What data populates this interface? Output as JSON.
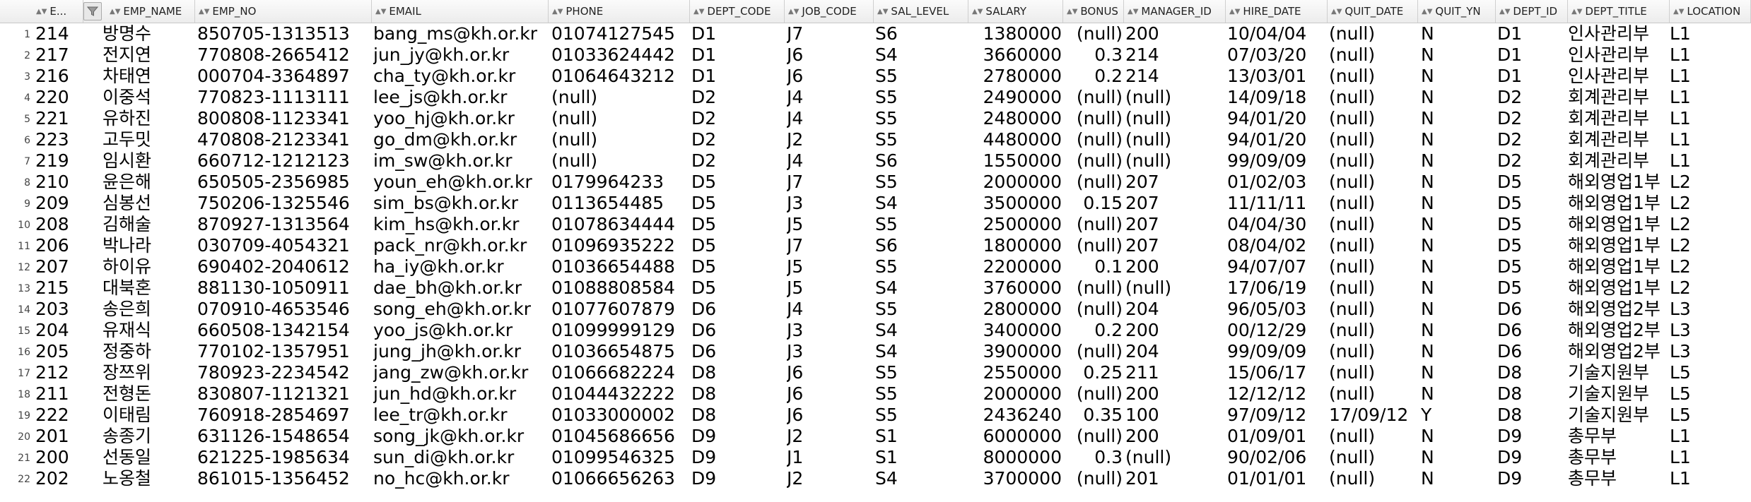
{
  "columns": [
    {
      "key": "EMP_ID",
      "label": "E..."
    },
    {
      "key": "EMP_NAME",
      "label": "EMP_NAME"
    },
    {
      "key": "EMP_NO",
      "label": "EMP_NO"
    },
    {
      "key": "EMAIL",
      "label": "EMAIL"
    },
    {
      "key": "PHONE",
      "label": "PHONE"
    },
    {
      "key": "DEPT_CODE",
      "label": "DEPT_CODE"
    },
    {
      "key": "JOB_CODE",
      "label": "JOB_CODE"
    },
    {
      "key": "SAL_LEVEL",
      "label": "SAL_LEVEL"
    },
    {
      "key": "SALARY",
      "label": "SALARY"
    },
    {
      "key": "BONUS",
      "label": "BONUS"
    },
    {
      "key": "MANAGER_ID",
      "label": "MANAGER_ID"
    },
    {
      "key": "HIRE_DATE",
      "label": "HIRE_DATE"
    },
    {
      "key": "QUIT_DATE",
      "label": "QUIT_DATE"
    },
    {
      "key": "QUIT_YN",
      "label": "QUIT_YN"
    },
    {
      "key": "DEPT_ID",
      "label": "DEPT_ID"
    },
    {
      "key": "DEPT_TITLE",
      "label": "DEPT_TITLE"
    },
    {
      "key": "LOCATION_ID",
      "label": "LOCATION"
    }
  ],
  "rows": [
    [
      "214",
      "방명수",
      "850705-1313513",
      "bang_ms@kh.or.kr",
      "01074127545",
      "D1",
      "J7",
      "S6",
      "1380000",
      "(null)",
      "200",
      "10/04/04",
      "(null)",
      "N",
      "D1",
      "인사관리부",
      "L1"
    ],
    [
      "217",
      "전지연",
      "770808-2665412",
      "jun_jy@kh.or.kr",
      "01033624442",
      "D1",
      "J6",
      "S4",
      "3660000",
      "0.3",
      "214",
      "07/03/20",
      "(null)",
      "N",
      "D1",
      "인사관리부",
      "L1"
    ],
    [
      "216",
      "차태연",
      "000704-3364897",
      "cha_ty@kh.or.kr",
      "01064643212",
      "D1",
      "J6",
      "S5",
      "2780000",
      "0.2",
      "214",
      "13/03/01",
      "(null)",
      "N",
      "D1",
      "인사관리부",
      "L1"
    ],
    [
      "220",
      "이중석",
      "770823-1113111",
      "lee_js@kh.or.kr",
      "(null)",
      "D2",
      "J4",
      "S5",
      "2490000",
      "(null)",
      "(null)",
      "14/09/18",
      "(null)",
      "N",
      "D2",
      "회계관리부",
      "L1"
    ],
    [
      "221",
      "유하진",
      "800808-1123341",
      "yoo_hj@kh.or.kr",
      "(null)",
      "D2",
      "J4",
      "S5",
      "2480000",
      "(null)",
      "(null)",
      "94/01/20",
      "(null)",
      "N",
      "D2",
      "회계관리부",
      "L1"
    ],
    [
      "223",
      "고두밋",
      "470808-2123341",
      "go_dm@kh.or.kr",
      "(null)",
      "D2",
      "J2",
      "S5",
      "4480000",
      "(null)",
      "(null)",
      "94/01/20",
      "(null)",
      "N",
      "D2",
      "회계관리부",
      "L1"
    ],
    [
      "219",
      "임시환",
      "660712-1212123",
      "im_sw@kh.or.kr",
      "(null)",
      "D2",
      "J4",
      "S6",
      "1550000",
      "(null)",
      "(null)",
      "99/09/09",
      "(null)",
      "N",
      "D2",
      "회계관리부",
      "L1"
    ],
    [
      "210",
      "윤은해",
      "650505-2356985",
      "youn_eh@kh.or.kr",
      "0179964233",
      "D5",
      "J7",
      "S5",
      "2000000",
      "(null)",
      "207",
      "01/02/03",
      "(null)",
      "N",
      "D5",
      "해외영업1부",
      "L2"
    ],
    [
      "209",
      "심봉선",
      "750206-1325546",
      "sim_bs@kh.or.kr",
      "0113654485",
      "D5",
      "J3",
      "S4",
      "3500000",
      "0.15",
      "207",
      "11/11/11",
      "(null)",
      "N",
      "D5",
      "해외영업1부",
      "L2"
    ],
    [
      "208",
      "김해술",
      "870927-1313564",
      "kim_hs@kh.or.kr",
      "01078634444",
      "D5",
      "J5",
      "S5",
      "2500000",
      "(null)",
      "207",
      "04/04/30",
      "(null)",
      "N",
      "D5",
      "해외영업1부",
      "L2"
    ],
    [
      "206",
      "박나라",
      "030709-4054321",
      "pack_nr@kh.or.kr",
      "01096935222",
      "D5",
      "J7",
      "S6",
      "1800000",
      "(null)",
      "207",
      "08/04/02",
      "(null)",
      "N",
      "D5",
      "해외영업1부",
      "L2"
    ],
    [
      "207",
      "하이유",
      "690402-2040612",
      "ha_iy@kh.or.kr",
      "01036654488",
      "D5",
      "J5",
      "S5",
      "2200000",
      "0.1",
      "200",
      "94/07/07",
      "(null)",
      "N",
      "D5",
      "해외영업1부",
      "L2"
    ],
    [
      "215",
      "대북혼",
      "881130-1050911",
      "dae_bh@kh.or.kr",
      "01088808584",
      "D5",
      "J5",
      "S4",
      "3760000",
      "(null)",
      "(null)",
      "17/06/19",
      "(null)",
      "N",
      "D5",
      "해외영업1부",
      "L2"
    ],
    [
      "203",
      "송은희",
      "070910-4653546",
      "song_eh@kh.or.kr",
      "01077607879",
      "D6",
      "J4",
      "S5",
      "2800000",
      "(null)",
      "204",
      "96/05/03",
      "(null)",
      "N",
      "D6",
      "해외영업2부",
      "L3"
    ],
    [
      "204",
      "유재식",
      "660508-1342154",
      "yoo_js@kh.or.kr",
      "01099999129",
      "D6",
      "J3",
      "S4",
      "3400000",
      "0.2",
      "200",
      "00/12/29",
      "(null)",
      "N",
      "D6",
      "해외영업2부",
      "L3"
    ],
    [
      "205",
      "정중하",
      "770102-1357951",
      "jung_jh@kh.or.kr",
      "01036654875",
      "D6",
      "J3",
      "S4",
      "3900000",
      "(null)",
      "204",
      "99/09/09",
      "(null)",
      "N",
      "D6",
      "해외영업2부",
      "L3"
    ],
    [
      "212",
      "장쯔위",
      "780923-2234542",
      "jang_zw@kh.or.kr",
      "01066682224",
      "D8",
      "J6",
      "S5",
      "2550000",
      "0.25",
      "211",
      "15/06/17",
      "(null)",
      "N",
      "D8",
      "기술지원부",
      "L5"
    ],
    [
      "211",
      "전형돈",
      "830807-1121321",
      "jun_hd@kh.or.kr",
      "01044432222",
      "D8",
      "J6",
      "S5",
      "2000000",
      "(null)",
      "200",
      "12/12/12",
      "(null)",
      "N",
      "D8",
      "기술지원부",
      "L5"
    ],
    [
      "222",
      "이태림",
      "760918-2854697",
      "lee_tr@kh.or.kr",
      "01033000002",
      "D8",
      "J6",
      "S5",
      "2436240",
      "0.35",
      "100",
      "97/09/12",
      "17/09/12",
      "Y",
      "D8",
      "기술지원부",
      "L5"
    ],
    [
      "201",
      "송종기",
      "631126-1548654",
      "song_jk@kh.or.kr",
      "01045686656",
      "D9",
      "J2",
      "S1",
      "6000000",
      "(null)",
      "200",
      "01/09/01",
      "(null)",
      "N",
      "D9",
      "총무부",
      "L1"
    ],
    [
      "200",
      "선동일",
      "621225-1985634",
      "sun_di@kh.or.kr",
      "01099546325",
      "D9",
      "J1",
      "S1",
      "8000000",
      "0.3",
      "(null)",
      "90/02/06",
      "(null)",
      "N",
      "D9",
      "총무부",
      "L1"
    ],
    [
      "202",
      "노옹철",
      "861015-1356452",
      "no_hc@kh.or.kr",
      "01066656263",
      "D9",
      "J2",
      "S4",
      "3700000",
      "(null)",
      "201",
      "01/01/01",
      "(null)",
      "N",
      "D9",
      "총무부",
      "L1"
    ]
  ]
}
